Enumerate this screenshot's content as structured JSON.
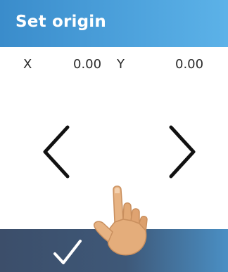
{
  "header": {
    "title": "Set origin",
    "color": "#4a9fd9"
  },
  "coordinates": {
    "x_label": "X",
    "x_value": "0.00",
    "y_label": "Y",
    "y_value": "0.00"
  },
  "controls": {
    "previous_icon": "chevron-left-icon",
    "next_icon": "chevron-right-icon",
    "confirm_icon": "checkmark-icon"
  },
  "footer": {
    "color": "#3e5878"
  },
  "overlay": {
    "icon": "pointing-hand-icon"
  }
}
